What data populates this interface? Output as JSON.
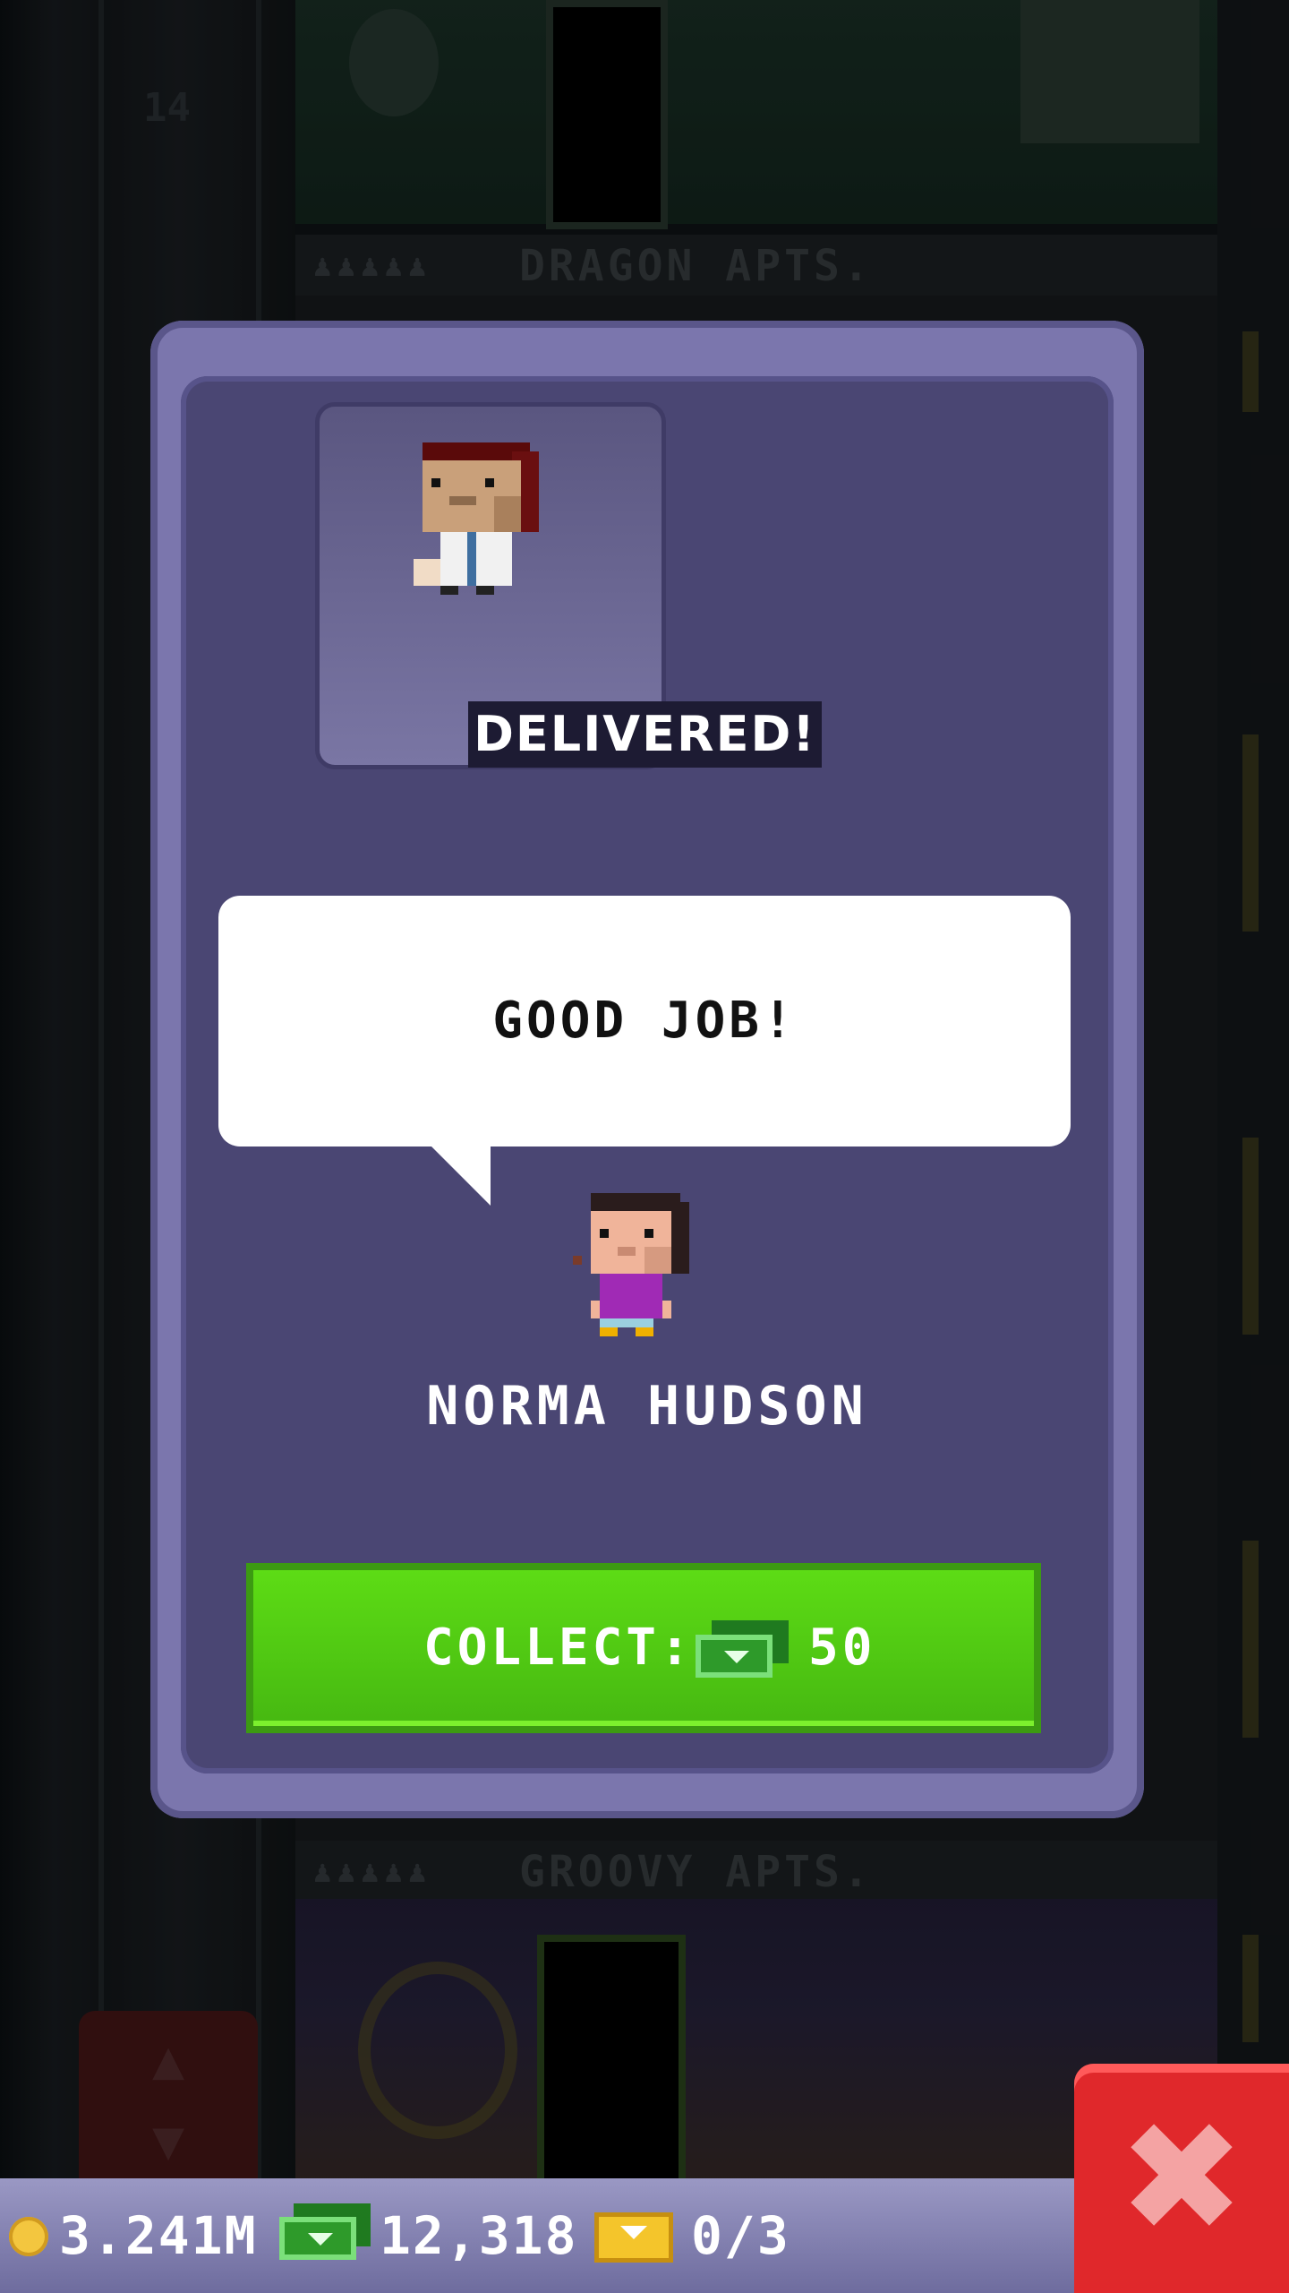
{
  "background": {
    "floor_number": "14",
    "top_floor_name": "DRAGON APTS.",
    "bottom_floor_name": "GROOVY APTS."
  },
  "dialog": {
    "status_banner": "DELIVERED!",
    "speech_text": "GOOD JOB!",
    "sender_name": "NORMA HUDSON",
    "collect": {
      "label": "COLLECT:",
      "currency_icon": "bux-icon",
      "value": "50"
    }
  },
  "status_bar": {
    "coins": "3.241M",
    "bux": "12,318",
    "tickets": "0/3"
  },
  "colors": {
    "dialog_bg": "#4a4673",
    "collect_green": "#4fcc12",
    "close_red": "#e0282b"
  }
}
